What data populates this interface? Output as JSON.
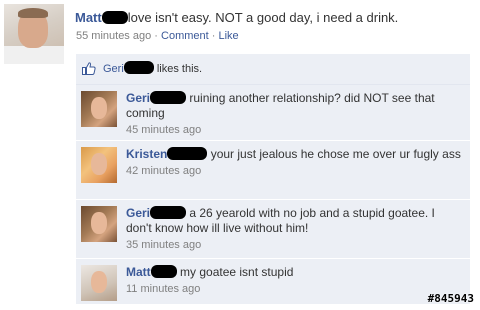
{
  "post": {
    "author": "Matt",
    "text": "love isn't easy. NOT a good day, i need a drink.",
    "time": "55 minutes ago",
    "separator": "·",
    "comment_link": "Comment",
    "like_link": "Like"
  },
  "likes": {
    "name": "Geri",
    "text": "likes this."
  },
  "comments": [
    {
      "name": "Geri",
      "text": "ruining another relationship? did NOT see that coming",
      "time": "45 minutes ago"
    },
    {
      "name": "Kristen",
      "text": "your just jealous he chose me over ur fugly ass",
      "time": "42 minutes ago"
    },
    {
      "name": "Geri",
      "text": "a 26 yearold with no job and a stupid goatee. I don't know how ill live without him!",
      "time": "35 minutes ago"
    },
    {
      "name": "Matt",
      "text": "my goatee isnt stupid",
      "time": "11 minutes ago"
    }
  ],
  "watermark": "#845943",
  "colors": {
    "link": "#3b5998",
    "comment_bg": "#eceff5",
    "meta": "#808080"
  },
  "icons": {
    "like": "thumbs-up-icon"
  }
}
